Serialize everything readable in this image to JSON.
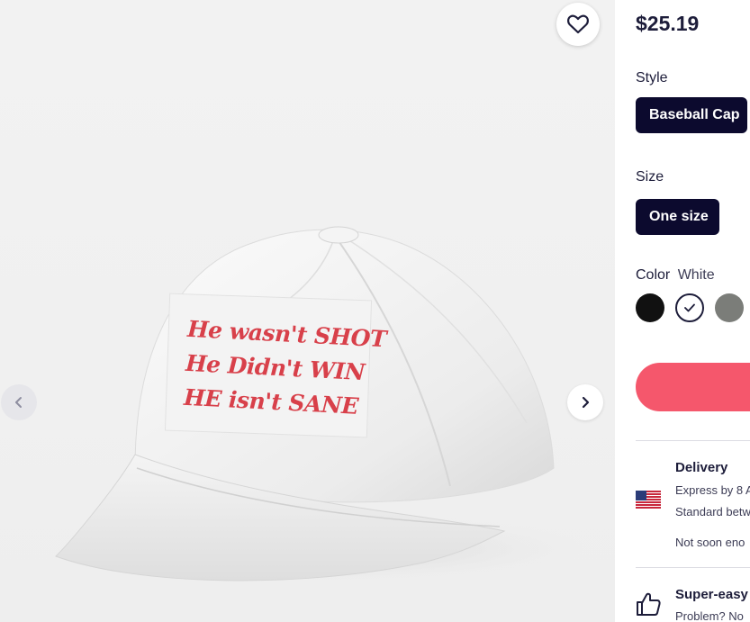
{
  "product": {
    "price": "$25.19",
    "image_text_lines": [
      "He wasn't SHOT",
      "He Didn't WIN",
      "HE isn't SANE"
    ],
    "text_color": "#d8404a"
  },
  "gallery": {
    "favorite_icon": "heart-outline-icon",
    "prev_icon": "chevron-left-icon",
    "next_icon": "chevron-right-icon"
  },
  "style": {
    "label": "Style",
    "selected": "Baseball Cap"
  },
  "size": {
    "label": "Size",
    "selected": "One size"
  },
  "color": {
    "label": "Color",
    "selected_name": "White",
    "swatches": [
      {
        "name": "Black",
        "hex": "#111111",
        "selected": false
      },
      {
        "name": "White",
        "hex": "#ffffff",
        "selected": true
      },
      {
        "name": "Gray",
        "hex": "#7b7d79",
        "selected": false
      }
    ]
  },
  "add_to_cart": {
    "color": "#f5576c"
  },
  "delivery": {
    "title": "Delivery",
    "express": "Express by 8 A",
    "standard": "Standard betw",
    "note": "Not soon eno",
    "flag_icon": "us-flag-icon"
  },
  "guarantee": {
    "title": "Super-easy",
    "text": "Problem? No",
    "icon": "thumbs-up-icon"
  }
}
